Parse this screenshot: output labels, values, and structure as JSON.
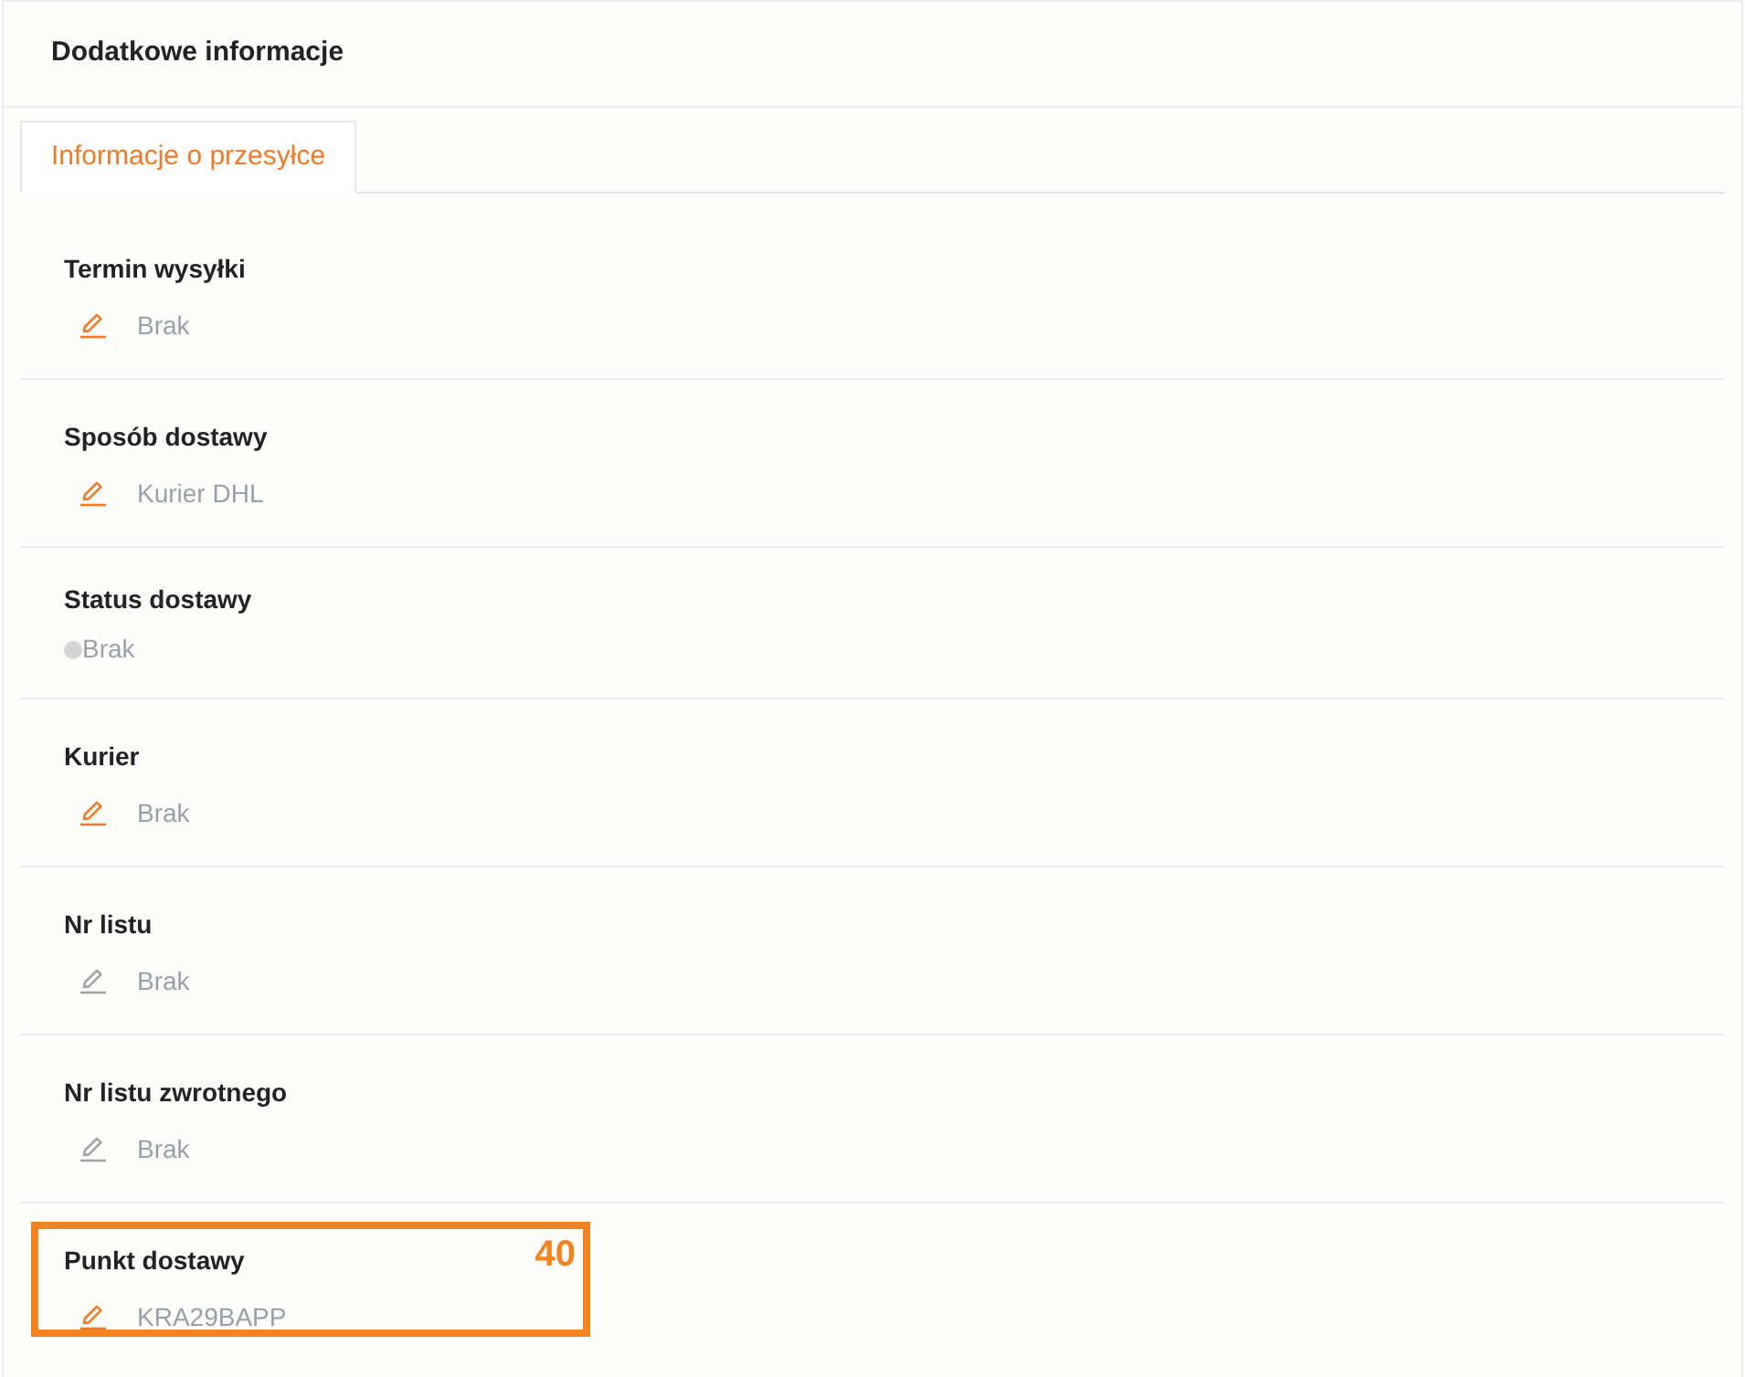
{
  "panel": {
    "title": "Dodatkowe informacje"
  },
  "tabs": [
    {
      "label": "Informacje o przesyłce",
      "selected": true
    }
  ],
  "fields": [
    {
      "kind": "editable",
      "label": "Termin wysyłki",
      "value": "Brak",
      "disabled": false
    },
    {
      "kind": "editable",
      "label": "Sposób dostawy",
      "value": "Kurier DHL",
      "disabled": false
    },
    {
      "kind": "status",
      "label": "Status dostawy",
      "value": "Brak",
      "color": "#d4d4d4"
    },
    {
      "kind": "editable",
      "label": "Kurier",
      "value": "Brak",
      "disabled": false
    },
    {
      "kind": "editable",
      "label": "Nr listu",
      "value": "Brak",
      "disabled": true
    },
    {
      "kind": "editable",
      "label": "Nr listu zwrotnego",
      "value": "Brak",
      "disabled": true
    },
    {
      "kind": "editable",
      "label": "Punkt dostawy",
      "value": "KRA29BAPP",
      "disabled": false,
      "marker": "40"
    }
  ]
}
